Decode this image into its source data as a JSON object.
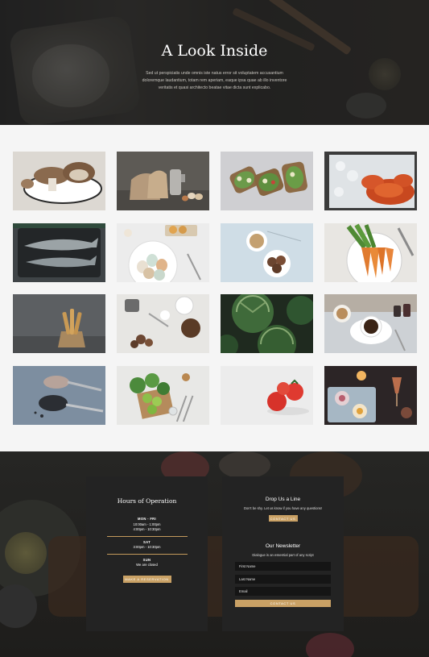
{
  "hero": {
    "title": "A Look Inside",
    "description": "Sed ut perspiciatis unde omnis iste natus error sit voluptatem accusantium doloremque laudantium, totam rem aperiam, eaque ipsa quae ab illo inventore veritatis et quasi architecto beatae vitae dicta sunt explicabo."
  },
  "gallery": {
    "images": [
      {
        "name": "mushrooms-image",
        "subject": "mushrooms on plate"
      },
      {
        "name": "flour-bags-image",
        "subject": "flour bags and pitcher"
      },
      {
        "name": "bruschetta-image",
        "subject": "bruschetta on paper"
      },
      {
        "name": "crab-on-ice-image",
        "subject": "crab on ice"
      },
      {
        "name": "fish-on-tray-image",
        "subject": "fish on tray"
      },
      {
        "name": "eggs-bowl-image",
        "subject": "eggs in bowl"
      },
      {
        "name": "cookies-tea-image",
        "subject": "cookies and tea"
      },
      {
        "name": "carrots-plate-image",
        "subject": "carrots on plate"
      },
      {
        "name": "bread-sticks-image",
        "subject": "bread sticks in bag"
      },
      {
        "name": "coffee-beans-image",
        "subject": "coffee beans and grinder"
      },
      {
        "name": "squash-image",
        "subject": "green squash"
      },
      {
        "name": "coffee-cup-image",
        "subject": "coffee cup"
      },
      {
        "name": "spices-spoons-image",
        "subject": "spices in spoons"
      },
      {
        "name": "limes-herbs-image",
        "subject": "limes and herbs"
      },
      {
        "name": "tomatoes-image",
        "subject": "tomatoes"
      },
      {
        "name": "desserts-tray-image",
        "subject": "desserts on tray"
      }
    ]
  },
  "hours": {
    "title": "Hours of Operation",
    "blocks": [
      {
        "day": "MON - FRI",
        "lines": [
          "10:00am - 1:00pm",
          "4:00pm - 10:30pm"
        ]
      },
      {
        "day": "SAT",
        "lines": [
          "3:00pm - 10:30pm"
        ]
      },
      {
        "day": "SUN",
        "lines": [
          "We are closed"
        ]
      }
    ],
    "button": "MAKE A RESERVATION"
  },
  "contact": {
    "title": "Drop Us a Line",
    "subtitle": "Don't be shy. Let us know if you have any questions!",
    "button": "CONTACT US"
  },
  "newsletter": {
    "title": "Our Newsletter",
    "subtitle": "Dialogue is an essential part of any script",
    "fields": {
      "first_name": "First Name",
      "last_name": "Last Name",
      "email": "Email"
    },
    "button": "CONTACT US"
  },
  "colors": {
    "accent": "#c9a165",
    "card_bg": "#232323",
    "field_bg": "#151515"
  }
}
